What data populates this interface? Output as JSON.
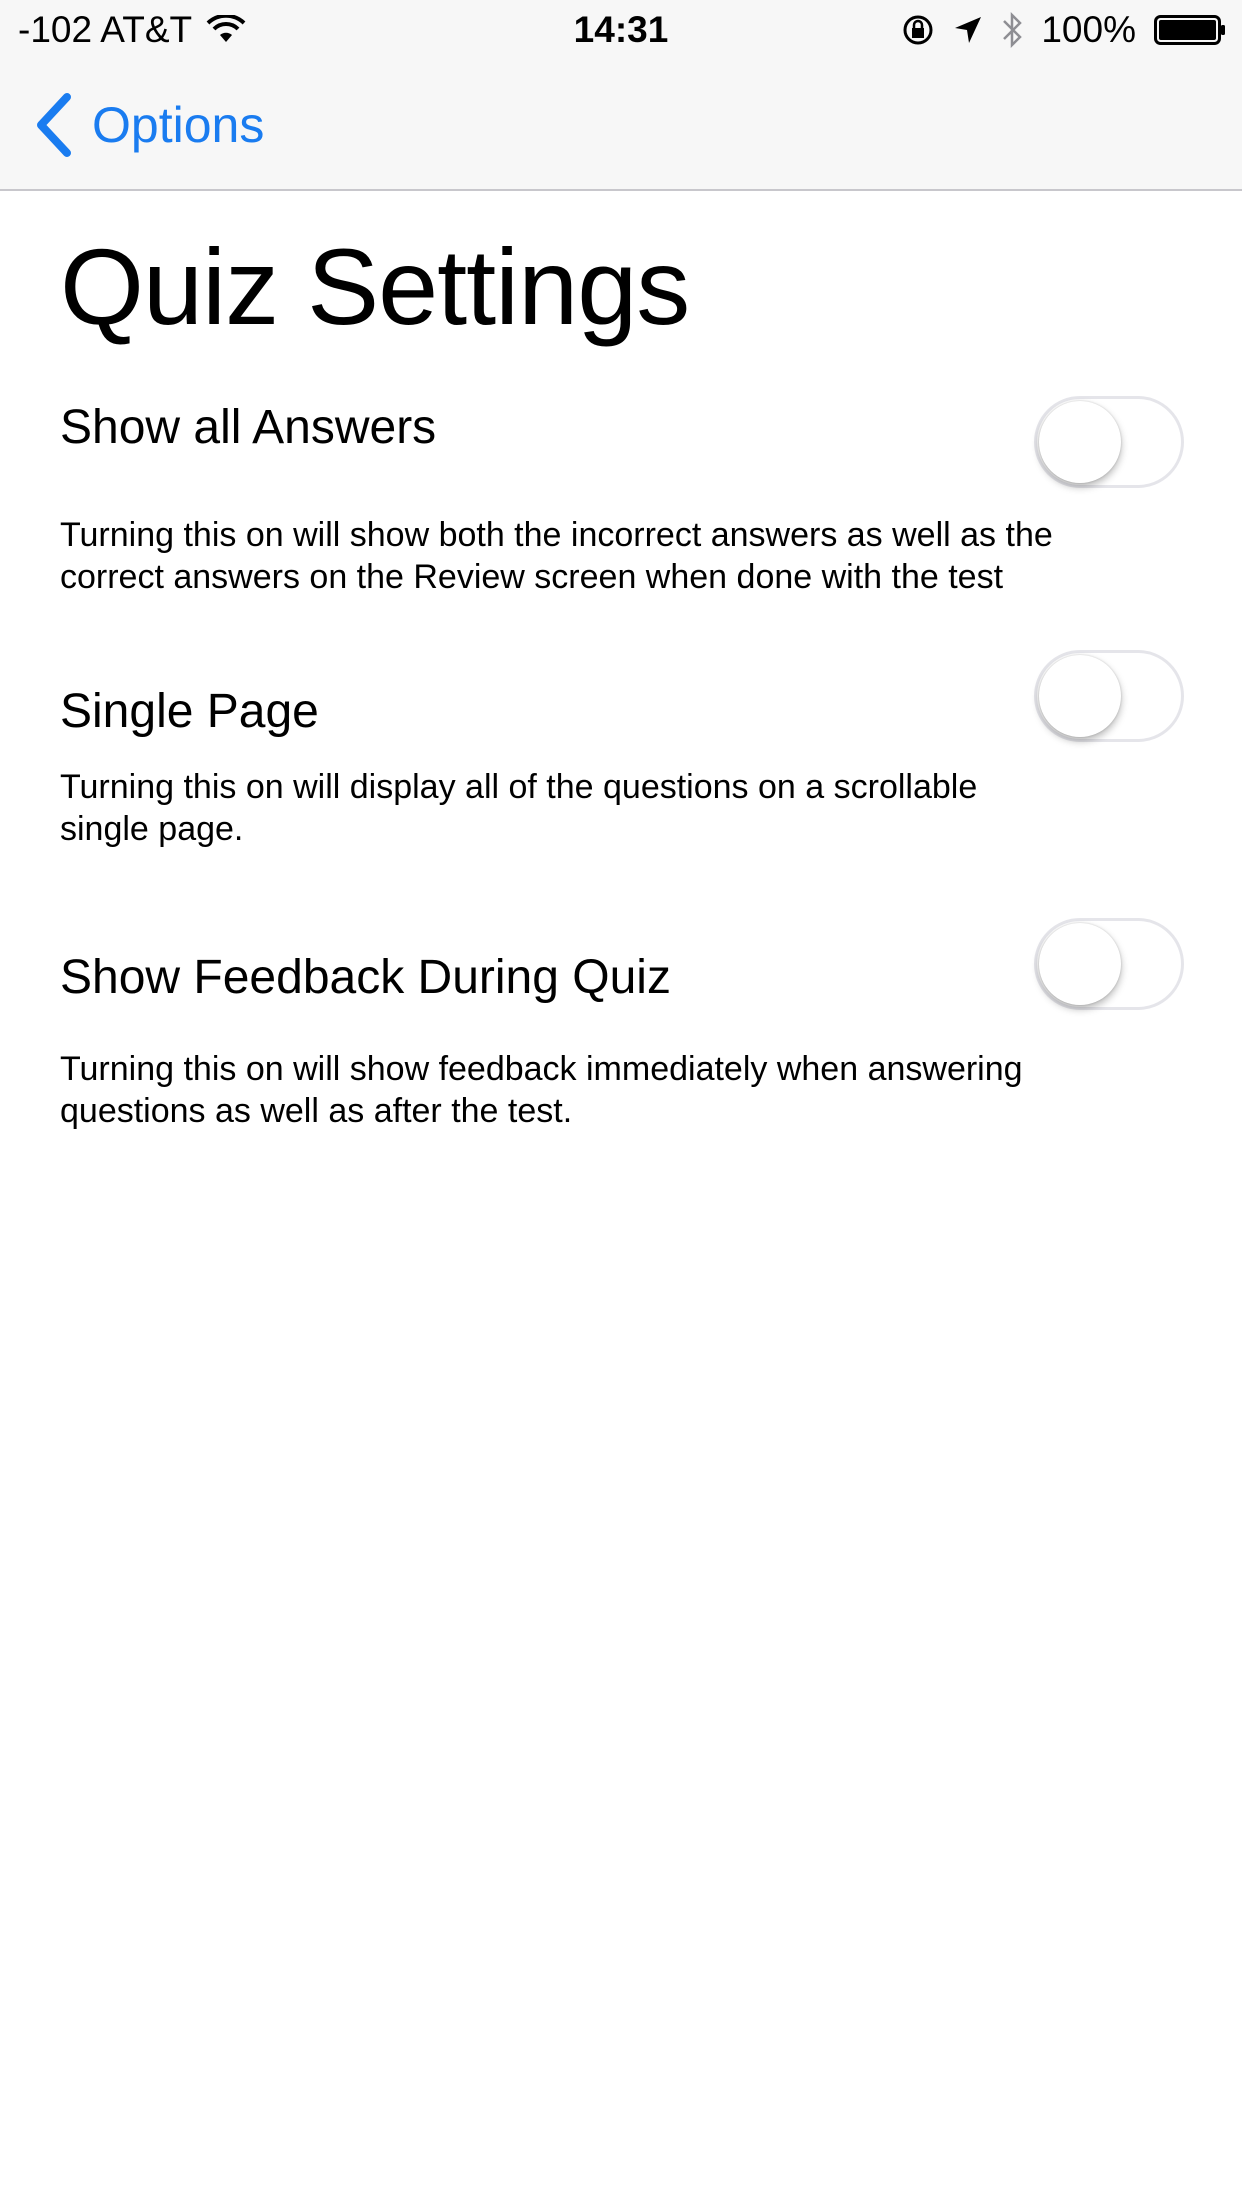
{
  "status_bar": {
    "carrier": "-102 AT&T",
    "time": "14:31",
    "battery": "100%"
  },
  "nav": {
    "back_label": "Options"
  },
  "title": "Quiz Settings",
  "settings": [
    {
      "label": "Show all Answers",
      "description_line1": "Turning this on will show both the incorrect answers as well as the",
      "description_line2": "correct answers on the Review screen when done with the test",
      "enabled": false
    },
    {
      "label": "Single Page",
      "description_line1": "Turning this on will display all of the questions on a scrollable",
      "description_line2": "single page.",
      "enabled": false
    },
    {
      "label": "Show Feedback During Quiz",
      "description_line1": "Turning this on will show feedback immediately when answering",
      "description_line2": "questions as well as after the test.",
      "enabled": false
    }
  ],
  "colors": {
    "accent": "#1a7cf0",
    "bar_background": "#f7f7f7",
    "toggle_border": "#e5e5ea"
  }
}
